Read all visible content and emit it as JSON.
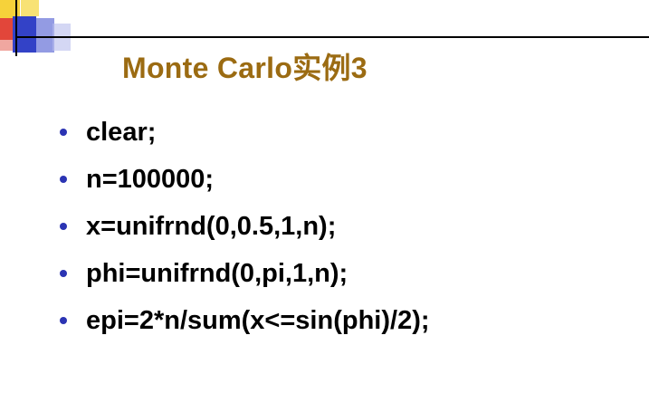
{
  "slide": {
    "title": "Monte Carlo实例3",
    "title_color": "#9b6b12",
    "bullet_color": "#2b34b3",
    "bullets": [
      "clear;",
      "n=100000;",
      "x=unifrnd(0,0.5,1,n);",
      "phi=unifrnd(0,pi,1,n);",
      "epi=2*n/sum(x<=sin(phi)/2);"
    ]
  }
}
